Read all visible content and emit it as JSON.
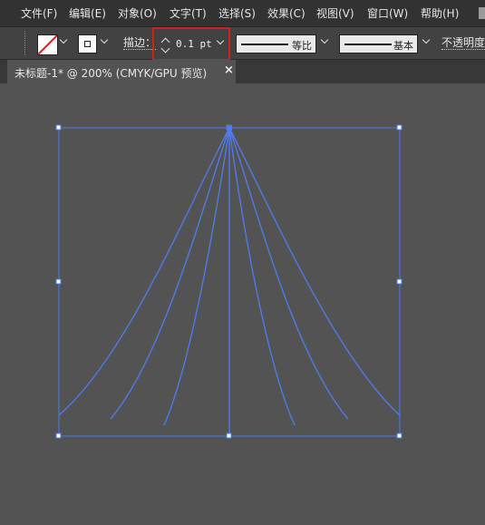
{
  "menu": {
    "items": [
      "文件(F)",
      "编辑(E)",
      "对象(O)",
      "文字(T)",
      "选择(S)",
      "效果(C)",
      "视图(V)",
      "窗口(W)",
      "帮助(H)"
    ]
  },
  "control": {
    "stroke_label": "描边：",
    "stroke_weight": "0.1 pt",
    "profile_label": "等比",
    "brush_label": "基本",
    "opacity_label": "不透明度"
  },
  "tab": {
    "title": "未标题-1* @ 200% (CMYK/GPU 预览)",
    "close": "×"
  },
  "colors": {
    "path_stroke": "#4f7df0",
    "selection": "#4a7be6",
    "highlight": "#d21f1f"
  },
  "icons": [
    "none-fill-icon",
    "stroke-swatch-icon",
    "spinner-icon",
    "chevron-down-icon",
    "close-icon"
  ]
}
